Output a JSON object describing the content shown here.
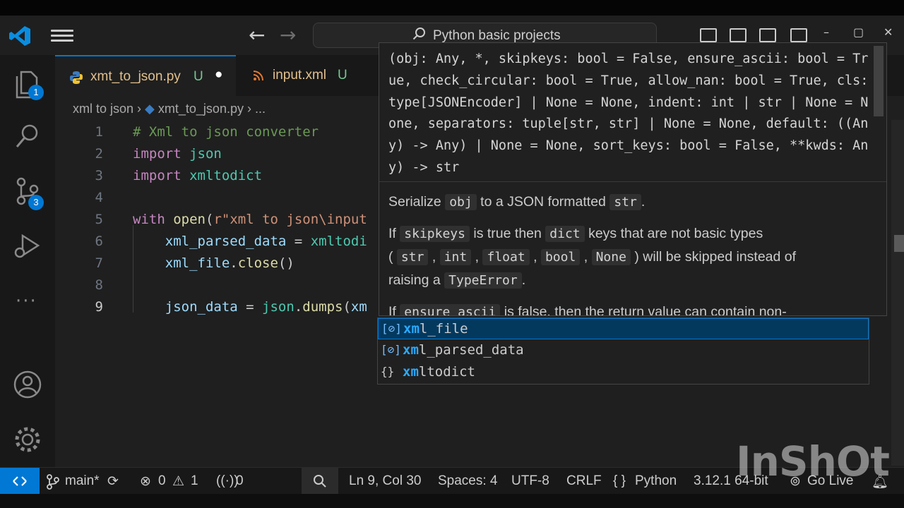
{
  "window": {
    "search_text": "Python basic projects",
    "window_controls": [
      "–",
      "▢",
      "✕"
    ]
  },
  "activity_bar": {
    "explorer_badge": "1",
    "source_control_badge": "3",
    "more_label": "···"
  },
  "tabs": [
    {
      "label": "xmt_to_json.py",
      "status": "U",
      "modified_dot": "●"
    },
    {
      "label": "input.xml",
      "status": "U"
    }
  ],
  "breadcrumb": {
    "folder": "xml to json",
    "file": "xmt_to_json.py",
    "ellipsis": "..."
  },
  "code": {
    "line_numbers": [
      "1",
      "2",
      "3",
      "4",
      "5",
      "6",
      "7",
      "8",
      "9"
    ],
    "current_line": 9
  },
  "hover": {
    "signature": "(obj: Any, *, skipkeys: bool = False, ensure_ascii: bool = True, check_circular: bool = True, allow_nan: bool = True, cls: type[JSONEncoder] | None = None, indent: int | str | None = None, separators: tuple[str, str] | None = None, default: ((Any) -> Any) | None = None, sort_keys: bool = False, **kwds: Any) -> str",
    "doc": {
      "serialize_pre": "Serialize",
      "serialize_obj": "obj",
      "serialize_mid": "to a JSON formatted",
      "serialize_str": "str",
      "serialize_end": ".",
      "p2_if": "If",
      "p2_skipkeys": "skipkeys",
      "p2_a": "is true then",
      "p2_dict": "dict",
      "p2_b": "keys that are not basic types",
      "p2_open": "(",
      "p2_str": "str",
      "p2_int": "int",
      "p2_float": "float",
      "p2_bool": "bool",
      "p2_none": "None",
      "p2_c": ") will be skipped instead of",
      "p2_raising": "raising a",
      "p2_typeerror": "TypeError",
      "p2_end": ".",
      "p3_if": "If",
      "p3_ensure": "ensure_ascii",
      "p3_rest": "is false, then the return value can contain non-"
    }
  },
  "suggestions": [
    {
      "icon": "[⊘]",
      "label": "xml_file",
      "selected": true
    },
    {
      "icon": "[⊘]",
      "label": "xml_parsed_data",
      "selected": false
    },
    {
      "icon": "{}",
      "label": "xmltodict",
      "selected": false
    }
  ],
  "status_bar": {
    "branch": "main*",
    "errors": "0",
    "warnings": "1",
    "ports": "0",
    "cursor": "Ln 9, Col 30",
    "spaces": "Spaces: 4",
    "encoding": "UTF-8",
    "eol": "CRLF",
    "language": "Python",
    "interpreter": "3.12.1 64-bit",
    "go_live": "Go Live"
  },
  "watermark": "InShOt",
  "colors": {
    "accent": "#0078d4",
    "keyword": "#c586c0",
    "function": "#dcdcaa",
    "variable": "#9cdcfe",
    "string": "#ce9178",
    "comment": "#6a9955"
  }
}
